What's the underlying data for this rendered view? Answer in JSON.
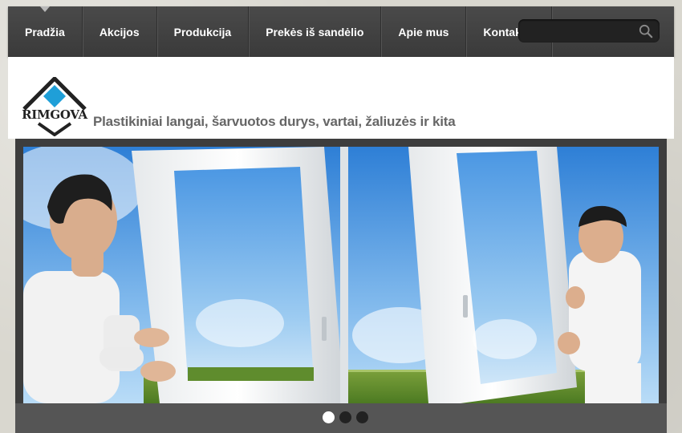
{
  "nav": {
    "items": [
      {
        "label": "Pradžia",
        "active": true
      },
      {
        "label": "Akcijos"
      },
      {
        "label": "Produkcija"
      },
      {
        "label": "Prekės iš sandėlio"
      },
      {
        "label": "Apie mus"
      },
      {
        "label": "Kontaktai"
      }
    ],
    "search": {
      "placeholder": "",
      "icon": "search-icon"
    }
  },
  "header": {
    "logo_text": "RIMGOVA",
    "tagline": "Plastikiniai langai, šarvuotos durys, vartai, žaliuzės ir kita"
  },
  "slider": {
    "slide_count": 3,
    "active_slide": 1
  },
  "colors": {
    "nav_bg": "#444444",
    "logo_diamond": "#1f9fd8",
    "tagline": "#666666"
  }
}
